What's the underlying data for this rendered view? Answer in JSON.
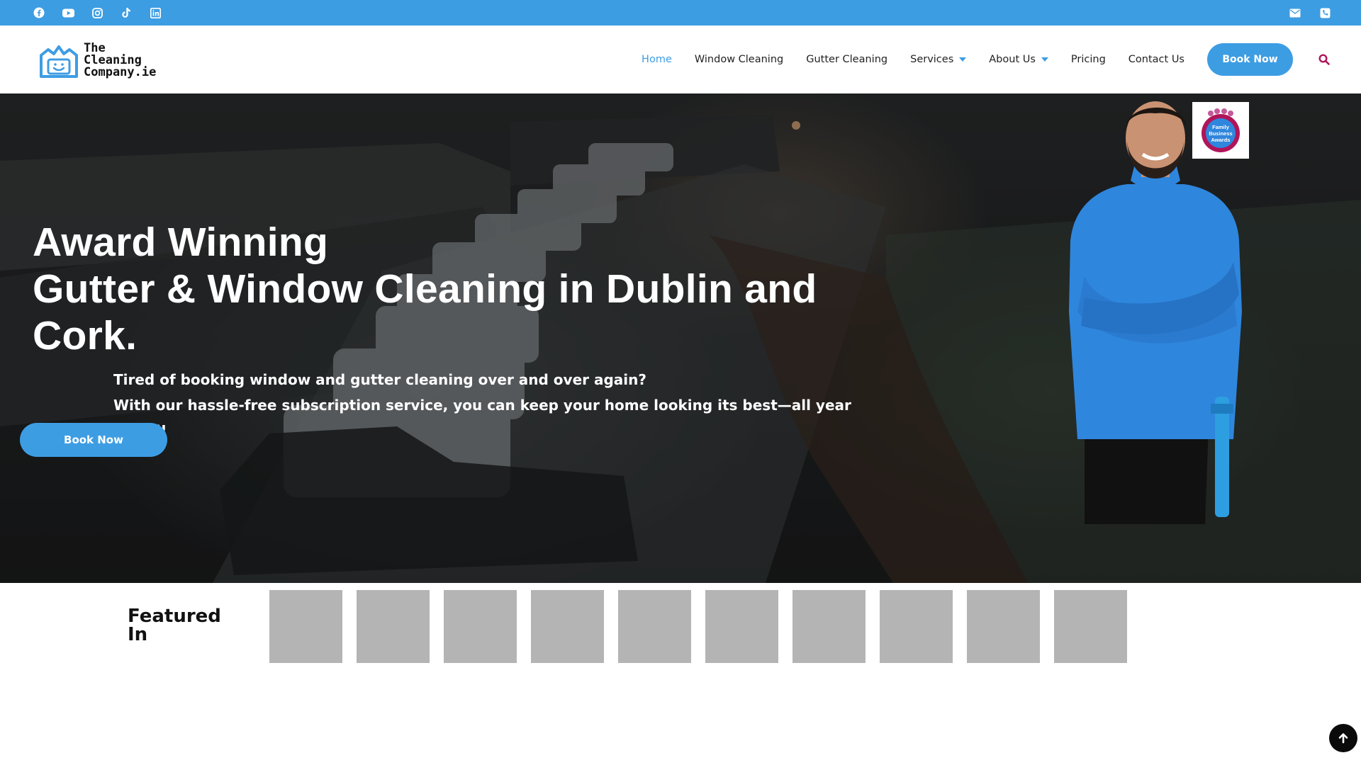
{
  "topbar": {
    "social_icons": [
      "facebook-icon",
      "youtube-icon",
      "instagram-icon",
      "tiktok-icon",
      "linkedin-icon"
    ],
    "contact_icons": [
      "email-icon",
      "phone-icon"
    ],
    "color": "#3d9de3"
  },
  "header": {
    "logo": {
      "line1": "The",
      "line2": "Cleaning",
      "line3": "Company.ie"
    },
    "nav": [
      {
        "label": "Home",
        "active": true
      },
      {
        "label": "Window Cleaning"
      },
      {
        "label": "Gutter Cleaning"
      },
      {
        "label": "Services",
        "dropdown": true
      },
      {
        "label": "About Us",
        "dropdown": true
      },
      {
        "label": "Pricing"
      },
      {
        "label": "Contact Us"
      }
    ],
    "book_button": "Book Now",
    "search_icon": "search-icon"
  },
  "hero": {
    "title_line1": "Award Winning",
    "title_line2": "Gutter & Window Cleaning in Dublin and",
    "title_line3": "Cork.",
    "subtitle_line1": "Tired of booking window and gutter cleaning over and over again?",
    "subtitle_line2": "With our hassle-free subscription service, you can keep your home looking its best—all year round!",
    "book_button": "Book Now",
    "award_badge": {
      "line1": "Family",
      "line2": "Business",
      "line3": "Awards"
    }
  },
  "featured": {
    "title_line1": "Featured",
    "title_line2": "In",
    "logos_count": 10
  },
  "accent_color": "#3d9de3",
  "accent_magenta": "#b0145a"
}
